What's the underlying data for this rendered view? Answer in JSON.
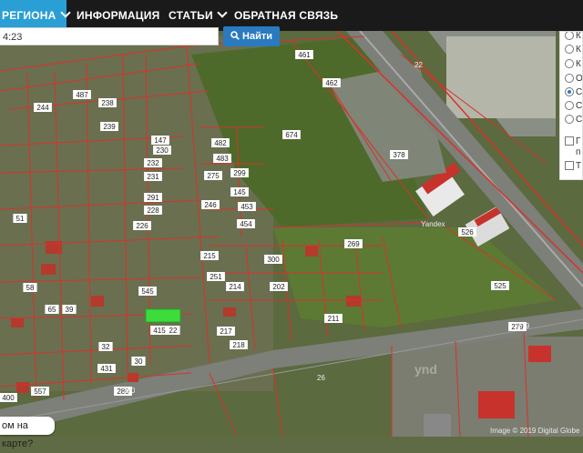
{
  "header": {
    "nav": [
      {
        "label": "РЕГИОНА",
        "has_caret": true
      },
      {
        "label": "ИНФОРМАЦИЯ",
        "has_caret": false
      },
      {
        "label": "СТАТЬИ",
        "has_caret": true
      },
      {
        "label": "ОБРАТНАЯ СВЯЗЬ",
        "has_caret": false
      }
    ]
  },
  "search": {
    "value": "4:23",
    "button_label": "Найти",
    "button_icon": "search-icon"
  },
  "layers": {
    "items": [
      {
        "label": "К",
        "type": "radio",
        "selected": false
      },
      {
        "label": "К",
        "type": "radio",
        "selected": false
      },
      {
        "label": "К",
        "type": "radio",
        "selected": false
      },
      {
        "label": "О",
        "type": "radio",
        "selected": false
      },
      {
        "label": "С",
        "type": "radio",
        "selected": true
      },
      {
        "label": "С",
        "type": "radio",
        "selected": false
      },
      {
        "label": "С",
        "type": "radio",
        "selected": false
      },
      {
        "label": "Г",
        "type": "checkbox",
        "selected": false
      },
      {
        "label": "п",
        "type": "text",
        "selected": false
      },
      {
        "label": "Т",
        "type": "checkbox",
        "selected": false
      }
    ]
  },
  "question_label": "ом на карте?",
  "attribution": "Image © 2019 Digital Globe",
  "watermark": "ynd",
  "road_labels": [
    "Yandex",
    "279",
    "280",
    "26",
    "22"
  ],
  "parcels": [
    {
      "id": "461"
    },
    {
      "id": "462"
    },
    {
      "id": "674"
    },
    {
      "id": "378"
    },
    {
      "id": "526"
    },
    {
      "id": "525"
    },
    {
      "id": "269"
    },
    {
      "id": "482"
    },
    {
      "id": "483"
    },
    {
      "id": "453"
    },
    {
      "id": "454"
    },
    {
      "id": "246"
    },
    {
      "id": "244"
    },
    {
      "id": "239"
    },
    {
      "id": "238"
    },
    {
      "id": "487"
    },
    {
      "id": "147"
    },
    {
      "id": "230"
    },
    {
      "id": "232"
    },
    {
      "id": "231"
    },
    {
      "id": "291"
    },
    {
      "id": "228"
    },
    {
      "id": "226"
    },
    {
      "id": "415"
    },
    {
      "id": "218"
    },
    {
      "id": "217"
    },
    {
      "id": "211"
    },
    {
      "id": "202"
    },
    {
      "id": "300"
    },
    {
      "id": "51"
    },
    {
      "id": "65"
    },
    {
      "id": "58"
    },
    {
      "id": "39"
    },
    {
      "id": "32"
    },
    {
      "id": "30"
    },
    {
      "id": "400"
    },
    {
      "id": "557"
    },
    {
      "id": "431"
    },
    {
      "id": "22"
    },
    {
      "id": "545"
    },
    {
      "id": "275"
    },
    {
      "id": "299"
    },
    {
      "id": "145"
    },
    {
      "id": "251"
    },
    {
      "id": "215"
    },
    {
      "id": "214"
    },
    {
      "id": "279"
    },
    {
      "id": "280"
    }
  ]
}
